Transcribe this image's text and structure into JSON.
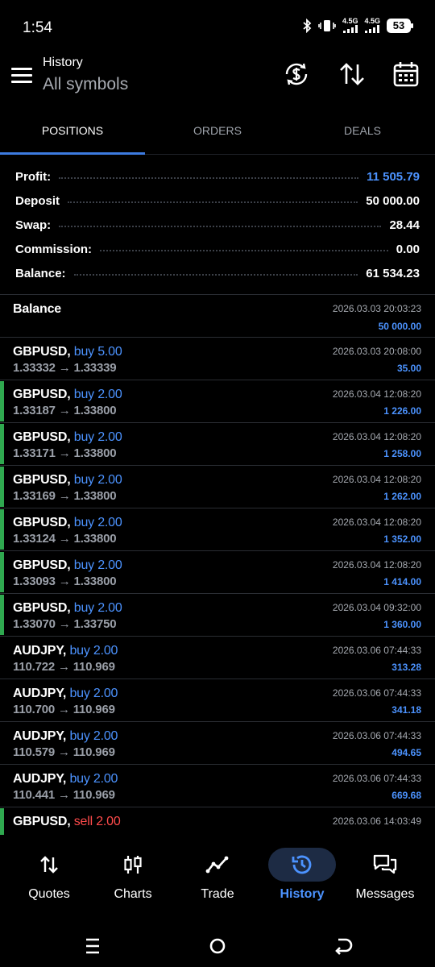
{
  "status": {
    "time": "1:54",
    "net1": "4.5G",
    "net2": "4.5G",
    "battery": "53"
  },
  "header": {
    "title": "History",
    "subtitle": "All symbols"
  },
  "tabs": [
    {
      "label": "POSITIONS",
      "active": true
    },
    {
      "label": "ORDERS",
      "active": false
    },
    {
      "label": "DEALS",
      "active": false
    }
  ],
  "summary": {
    "profit_label": "Profit:",
    "profit": "11 505.79",
    "deposit_label": "Deposit",
    "deposit": "50 000.00",
    "swap_label": "Swap:",
    "swap": "28.44",
    "commission_label": "Commission:",
    "commission": "0.00",
    "balance_label": "Balance:",
    "balance": "61 534.23"
  },
  "balance_row": {
    "label": "Balance",
    "date": "2026.03.03 20:03:23",
    "amount": "50 000.00"
  },
  "positions": [
    {
      "symbol": "GBPUSD,",
      "side": "buy 5.00",
      "prices": "1.33332 → 1.33339",
      "date": "2026.03.03 20:08:00",
      "profit": "35.00",
      "bar": false
    },
    {
      "symbol": "GBPUSD,",
      "side": "buy 2.00",
      "prices": "1.33187 → 1.33800",
      "date": "2026.03.04 12:08:20",
      "profit": "1 226.00",
      "bar": true
    },
    {
      "symbol": "GBPUSD,",
      "side": "buy 2.00",
      "prices": "1.33171 → 1.33800",
      "date": "2026.03.04 12:08:20",
      "profit": "1 258.00",
      "bar": true
    },
    {
      "symbol": "GBPUSD,",
      "side": "buy 2.00",
      "prices": "1.33169 → 1.33800",
      "date": "2026.03.04 12:08:20",
      "profit": "1 262.00",
      "bar": true
    },
    {
      "symbol": "GBPUSD,",
      "side": "buy 2.00",
      "prices": "1.33124 → 1.33800",
      "date": "2026.03.04 12:08:20",
      "profit": "1 352.00",
      "bar": true
    },
    {
      "symbol": "GBPUSD,",
      "side": "buy 2.00",
      "prices": "1.33093 → 1.33800",
      "date": "2026.03.04 12:08:20",
      "profit": "1 414.00",
      "bar": true
    },
    {
      "symbol": "GBPUSD,",
      "side": "buy 2.00",
      "prices": "1.33070 → 1.33750",
      "date": "2026.03.04 09:32:00",
      "profit": "1 360.00",
      "bar": true
    },
    {
      "symbol": "AUDJPY,",
      "side": "buy 2.00",
      "prices": "110.722 → 110.969",
      "date": "2026.03.06 07:44:33",
      "profit": "313.28",
      "bar": false
    },
    {
      "symbol": "AUDJPY,",
      "side": "buy 2.00",
      "prices": "110.700 → 110.969",
      "date": "2026.03.06 07:44:33",
      "profit": "341.18",
      "bar": false
    },
    {
      "symbol": "AUDJPY,",
      "side": "buy 2.00",
      "prices": "110.579 → 110.969",
      "date": "2026.03.06 07:44:33",
      "profit": "494.65",
      "bar": false
    },
    {
      "symbol": "AUDJPY,",
      "side": "buy 2.00",
      "prices": "110.441 → 110.969",
      "date": "2026.03.06 07:44:33",
      "profit": "669.68",
      "bar": false
    },
    {
      "symbol": "GBPUSD,",
      "side": "sell 2.00",
      "prices": "",
      "date": "2026.03.06 14:03:49",
      "profit": "",
      "bar": true
    }
  ],
  "bottom_nav": [
    {
      "label": "Quotes",
      "icon": "quotes-arrows-icon",
      "active": false
    },
    {
      "label": "Charts",
      "icon": "candlestick-icon",
      "active": false
    },
    {
      "label": "Trade",
      "icon": "trend-line-icon",
      "active": false
    },
    {
      "label": "History",
      "icon": "history-clock-icon",
      "active": true
    },
    {
      "label": "Messages",
      "icon": "chat-bubbles-icon",
      "active": false
    }
  ],
  "colors": {
    "accent": "#4c93ff",
    "sell": "#ff4b4b",
    "profit_bar": "#2fa84f",
    "background": "#000000"
  }
}
